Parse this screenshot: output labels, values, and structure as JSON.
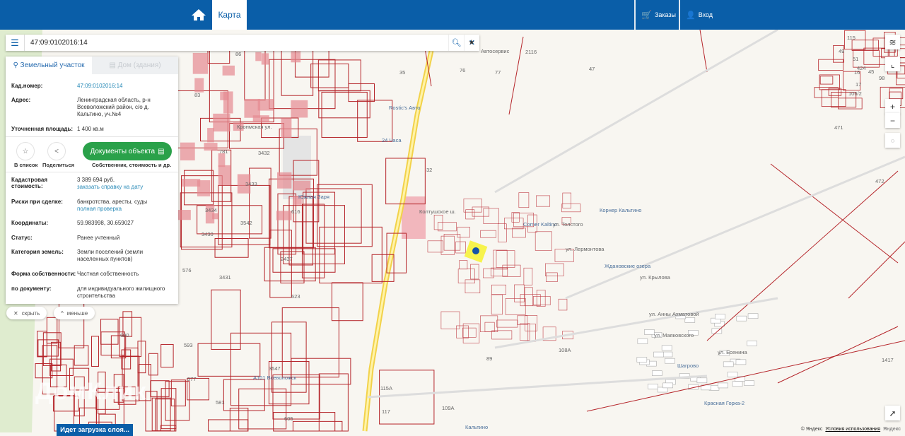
{
  "header": {
    "home_icon": "home-icon",
    "tab_map": "Карта",
    "orders": "Заказы",
    "login": "Вход",
    "brand_color": "#0a5ea8"
  },
  "search": {
    "value": "47:09:0102016:14"
  },
  "panel": {
    "tab_land": "Земельный участок",
    "tab_house": "Дом (здания)",
    "rows_top": [
      {
        "k": "Кад.номер:",
        "v": "47:09:0102016:14"
      },
      {
        "k": "Адрес:",
        "v": "Ленинградская область, р-н Всеволожский район, с/о д. Кальтино, уч.№4"
      },
      {
        "k": "Уточненная площадь:",
        "v": "1 400 кв.м"
      }
    ],
    "add_to_list": "В список",
    "share": "Поделиться",
    "documents": "Документы объекта",
    "documents_sub": "Собственник, стоимость и др.",
    "cadastral_value_k": "Кадастровая стоимость:",
    "cadastral_value": "3 389 694 руб.",
    "order_report": "заказать справку на дату",
    "risks_k": "Риски при сделке:",
    "risks": "банкротства, аресты, суды",
    "full_check": "полная проверка",
    "rows_bottom": [
      {
        "k": "Координаты:",
        "v": "59.983998, 30.659027"
      },
      {
        "k": "Статус:",
        "v": "Ранее учтенный"
      },
      {
        "k": "Категория земель:",
        "v": "Земли поселений (земли населенных пунктов)"
      },
      {
        "k": "Форма собственности:",
        "v": "Частная собственность"
      },
      {
        "k": "по документу:",
        "v": "для индивидуального жилищного строительства"
      }
    ],
    "hide": "скрыть",
    "less": "меньше",
    "action_color": "#2aa14a"
  },
  "map": {
    "labels": [
      "Южная Заря",
      "Rostic's Авто",
      "24 Часа",
      "Corner Kaltino",
      "Корнер Кальтино",
      "Ждановские озера",
      "Шагрово",
      "Красная Горка-2",
      "Кальтино",
      "А101 Всеволожск",
      "ул. Толстого",
      "ул. Лермонтова",
      "ул. Крылова",
      "Колтушское ш.",
      "Кронмская ул.",
      "ул. Анны Ахматовой",
      "ул. Маяковского",
      "ул. Есенина",
      "Автосервис"
    ],
    "parcels": [
      "86",
      "83",
      "781",
      "3432",
      "3433",
      "3434",
      "3542",
      "3430",
      "576",
      "3431",
      "2437",
      "623",
      "616",
      "593",
      "577",
      "581",
      "605",
      "3547",
      "600",
      "472",
      "471",
      "1417",
      "47",
      "2116",
      "76",
      "77",
      "35",
      "32",
      "115A",
      "109A",
      "108A",
      "89",
      "117",
      "16",
      "49",
      "424",
      "45",
      "98",
      "17",
      "106/2",
      "115",
      "51"
    ],
    "loading": "Идет загрузка слоя...",
    "watermark": "ДомКлик",
    "copyright": "© Яндекс",
    "terms": "Условия использования",
    "yandex": "Яндекс"
  }
}
